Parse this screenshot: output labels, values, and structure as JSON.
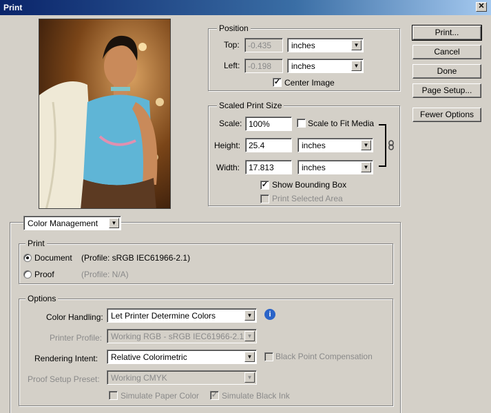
{
  "window": {
    "title": "Print",
    "close_glyph": "✕"
  },
  "position": {
    "group_label": "Position",
    "top_label": "Top:",
    "top_value": "-0.435",
    "top_unit": "inches",
    "left_label": "Left:",
    "left_value": "-0.198",
    "left_unit": "inches",
    "center_image_label": "Center Image",
    "center_image_checked": true
  },
  "scaled": {
    "group_label": "Scaled Print Size",
    "scale_label": "Scale:",
    "scale_value": "100%",
    "scale_to_fit_label": "Scale to Fit Media",
    "scale_to_fit_checked": false,
    "height_label": "Height:",
    "height_value": "25.4",
    "height_unit": "inches",
    "width_label": "Width:",
    "width_value": "17.813",
    "width_unit": "inches",
    "show_bounding_box_label": "Show Bounding Box",
    "show_bounding_box_checked": true,
    "print_selected_area_label": "Print Selected Area",
    "print_selected_area_checked": false
  },
  "buttons": {
    "print": "Print...",
    "cancel": "Cancel",
    "done": "Done",
    "page_setup": "Page Setup...",
    "fewer_options": "Fewer Options"
  },
  "color_management": {
    "section_select": "Color Management",
    "print_group_label": "Print",
    "document_label": "Document",
    "document_profile": "(Profile: sRGB IEC61966-2.1)",
    "proof_label": "Proof",
    "proof_profile": "(Profile: N/A)",
    "selected": "Document"
  },
  "options": {
    "group_label": "Options",
    "color_handling_label": "Color Handling:",
    "color_handling_value": "Let Printer Determine Colors",
    "printer_profile_label": "Printer Profile:",
    "printer_profile_value": "Working RGB - sRGB IEC61966-2.1",
    "rendering_intent_label": "Rendering Intent:",
    "rendering_intent_value": "Relative Colorimetric",
    "black_point_label": "Black Point Compensation",
    "black_point_checked": false,
    "proof_setup_label": "Proof Setup Preset:",
    "proof_setup_value": "Working CMYK",
    "simulate_paper_label": "Simulate Paper Color",
    "simulate_paper_checked": false,
    "simulate_black_label": "Simulate Black Ink",
    "simulate_black_checked": true
  },
  "icons": {
    "dropdown_arrow": "▼",
    "check": "✓",
    "info": "i",
    "link": "link-icon"
  },
  "colors": {
    "dialog_bg": "#d4d0c8",
    "title_bar": "#0a246a",
    "info_icon": "#2b64c8"
  }
}
